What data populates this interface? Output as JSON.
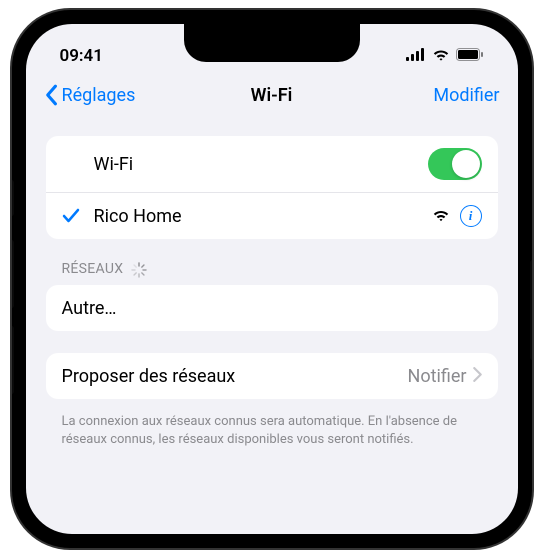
{
  "status": {
    "time": "09:41"
  },
  "nav": {
    "back": "Réglages",
    "title": "Wi-Fi",
    "right": "Modifier"
  },
  "wifi": {
    "toggle_label": "Wi-Fi",
    "connected_network": "Rico Home"
  },
  "networks": {
    "header": "Réseaux",
    "other": "Autre…"
  },
  "ask": {
    "label": "Proposer des réseaux",
    "value": "Notifier"
  },
  "footer": "La connexion aux réseaux connus sera automatique. En l'absence de réseaux connus, les réseaux disponibles vous seront notifiés."
}
